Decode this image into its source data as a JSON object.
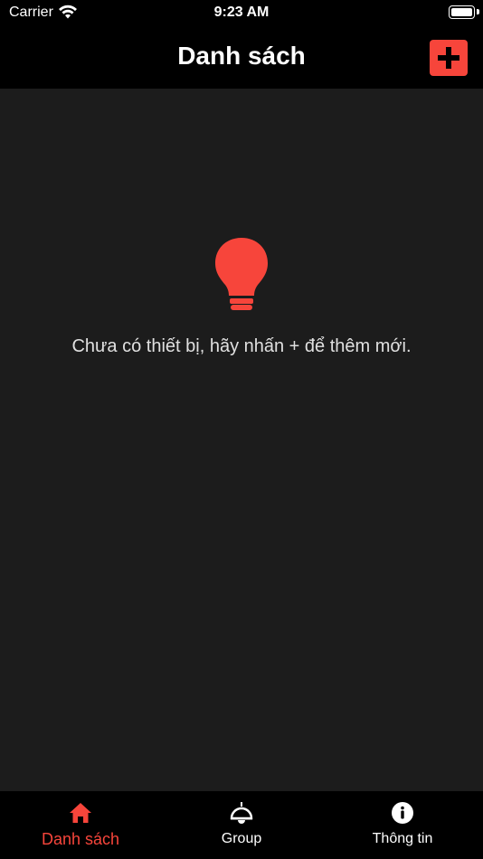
{
  "status_bar": {
    "carrier": "Carrier",
    "time": "9:23 AM"
  },
  "nav": {
    "title": "Danh sách",
    "add_icon": "plus-icon"
  },
  "content": {
    "icon": "lightbulb-icon",
    "empty_message": "Chưa có thiết bị, hãy nhấn + để thêm mới."
  },
  "tab_bar": {
    "tabs": [
      {
        "label": "Danh sách",
        "icon": "home-icon",
        "active": true
      },
      {
        "label": "Group",
        "icon": "ceiling-lamp-icon",
        "active": false
      },
      {
        "label": "Thông tin",
        "icon": "info-icon",
        "active": false
      }
    ]
  },
  "colors": {
    "accent": "#f7453b",
    "background": "#1c1c1c",
    "bar": "#000000",
    "text": "#ffffff"
  }
}
